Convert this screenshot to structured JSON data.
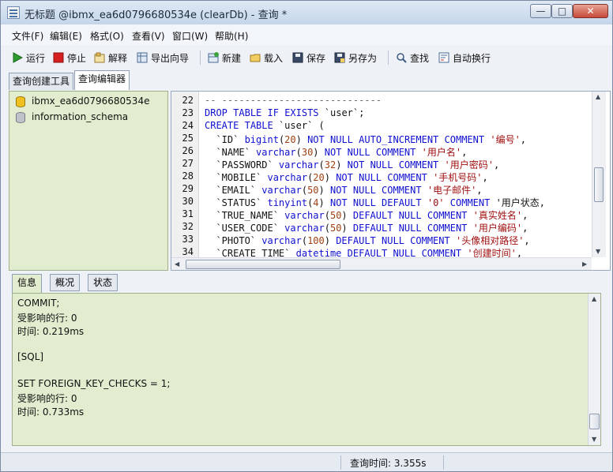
{
  "window": {
    "title": "无标题 @ibmx_ea6d0796680534e (clearDb) - 查询 *",
    "min_label": "—",
    "max_label": "□",
    "close_label": "✕"
  },
  "menu": [
    {
      "label": "文件(F)"
    },
    {
      "label": "编辑(E)"
    },
    {
      "label": "格式(O)"
    },
    {
      "label": "查看(V)"
    },
    {
      "label": "窗口(W)"
    },
    {
      "label": "帮助(H)"
    }
  ],
  "toolbar": {
    "run": "运行",
    "stop": "停止",
    "explain": "解释",
    "export_wizard": "导出向导",
    "new": "新建",
    "load": "载入",
    "save": "保存",
    "save_as": "另存为",
    "find": "查找",
    "word_wrap": "自动换行"
  },
  "tabs": {
    "query_builder": "查询创建工具",
    "query_editor": "查询编辑器"
  },
  "tree": {
    "items": [
      {
        "label": "ibmx_ea6d0796680534e"
      },
      {
        "label": "information_schema"
      }
    ]
  },
  "editor": {
    "line_numbers": [
      "22",
      "23",
      "24",
      "25",
      "26",
      "27",
      "28",
      "29",
      "30",
      "31",
      "32",
      "33",
      "34"
    ],
    "lines": [
      "-- ----------------------------",
      "DROP TABLE IF EXISTS `user`;",
      "CREATE TABLE `user` (",
      "  `ID` bigint(20) NOT NULL AUTO_INCREMENT COMMENT '编号',",
      "  `NAME` varchar(30) NOT NULL COMMENT '用户名',",
      "  `PASSWORD` varchar(32) NOT NULL COMMENT '用户密码',",
      "  `MOBILE` varchar(20) NOT NULL COMMENT '手机号码',",
      "  `EMAIL` varchar(50) NOT NULL COMMENT '电子邮件',",
      "  `STATUS` tinyint(4) NOT NULL DEFAULT '0' COMMENT '用户状态,",
      "  `TRUE_NAME` varchar(50) DEFAULT NULL COMMENT '真实姓名',",
      "  `USER_CODE` varchar(50) DEFAULT NULL COMMENT '用户编码',",
      "  `PHOTO` varchar(100) DEFAULT NULL COMMENT '头像相对路径',",
      "  `CREATE_TIME` datetime DEFAULT NULL COMMENT '创建时间',"
    ]
  },
  "bottom_tabs": {
    "info": "信息",
    "overview": "概况",
    "status": "状态"
  },
  "info": {
    "lines": [
      "COMMIT;",
      "受影响的行: 0",
      "时间: 0.219ms",
      "",
      "[SQL]",
      "",
      "SET FOREIGN_KEY_CHECKS = 1;",
      "受影响的行: 0",
      "时间: 0.733ms"
    ]
  },
  "status": {
    "query_time": "查询时间: 3.355s"
  },
  "colors": {
    "keyword": "#1010d0",
    "string": "#a01010",
    "pane_green": "#e2edd0"
  }
}
